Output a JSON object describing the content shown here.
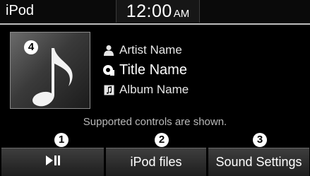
{
  "status_bar": {
    "title": "iPod",
    "time": "12:00",
    "ampm": "AM"
  },
  "track": {
    "artist": "Artist Name",
    "title": "Title Name",
    "album": "Album Name",
    "artist_icon": "person-icon",
    "title_icon": "song-title-icon",
    "album_icon": "album-icon",
    "art_icon": "music-note-icon"
  },
  "hint": "Supported controls are shown.",
  "buttons": {
    "play_pause_icon": "play-pause-icon",
    "ipod_files_label": "iPod files",
    "sound_settings_label": "Sound Settings"
  },
  "callouts": {
    "c1": "1",
    "c2": "2",
    "c3": "3",
    "c4": "4"
  },
  "colors": {
    "background": "#000000",
    "text": "#ffffff",
    "hint_text": "#b9b9b9",
    "button_top": "#3e3e3e",
    "button_bottom": "#1e1e1e"
  }
}
